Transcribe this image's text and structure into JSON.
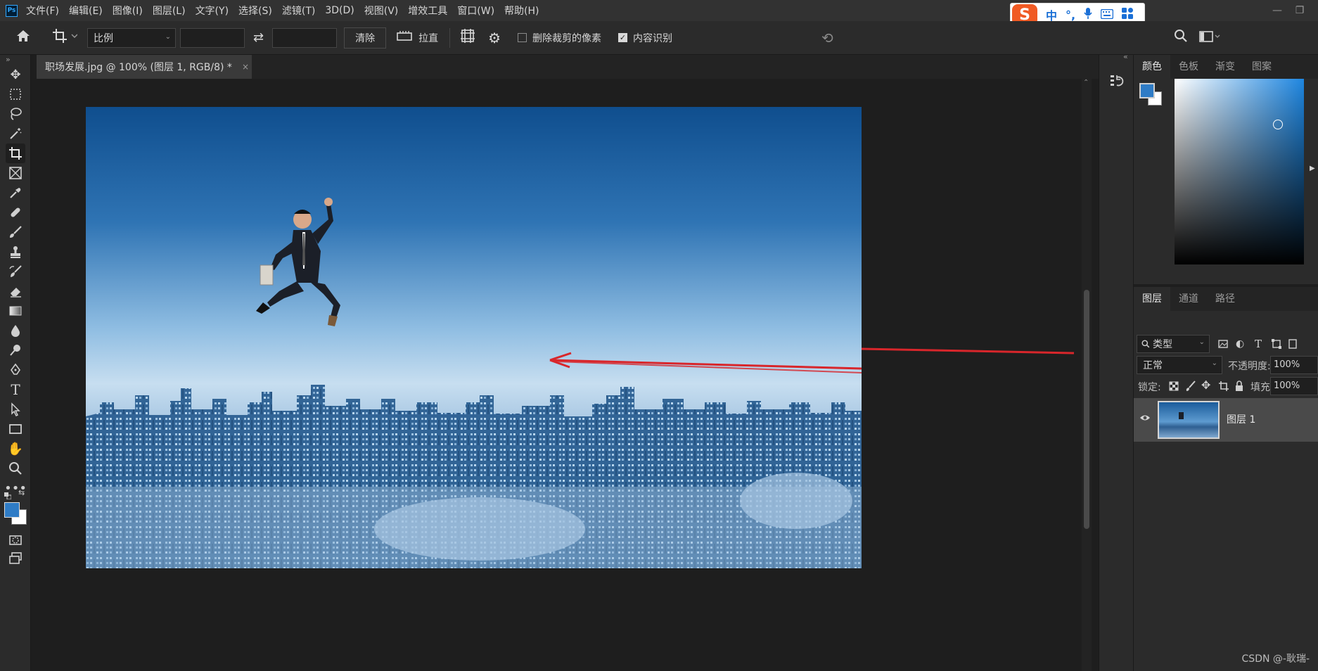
{
  "menubar": {
    "logo": "Ps",
    "items": [
      "文件(F)",
      "编辑(E)",
      "图像(I)",
      "图层(L)",
      "文字(Y)",
      "选择(S)",
      "滤镜(T)",
      "3D(D)",
      "视图(V)",
      "增效工具",
      "窗口(W)",
      "帮助(H)"
    ]
  },
  "ime": {
    "logo": "S",
    "mode": "中",
    "punct": "°,",
    "mic": "mic-icon",
    "keyboard": "keyboard-icon",
    "apps": "apps-icon"
  },
  "options": {
    "ratio_label": "比例",
    "clear_label": "清除",
    "straighten_label": "拉直",
    "delete_cropped_label": "删除裁剪的像素",
    "content_aware_label": "内容识别"
  },
  "document": {
    "tab_title": "职场发展.jpg @ 100% (图层 1, RGB/8) *",
    "close": "×"
  },
  "color_panel": {
    "tabs": [
      "颜色",
      "色板",
      "渐变",
      "图案"
    ],
    "foreground": "#2f7cc6",
    "background": "#ffffff"
  },
  "layers_panel": {
    "tabs": [
      "图层",
      "通道",
      "路径"
    ],
    "filter_label": "类型",
    "blend_mode": "正常",
    "opacity_label": "不透明度:",
    "opacity_value": "100%",
    "lock_label": "锁定:",
    "fill_label": "填充:",
    "fill_value": "100%",
    "layers": [
      {
        "name": "图层 1",
        "visible": true
      }
    ]
  },
  "watermark": "CSDN @-耿瑞-"
}
